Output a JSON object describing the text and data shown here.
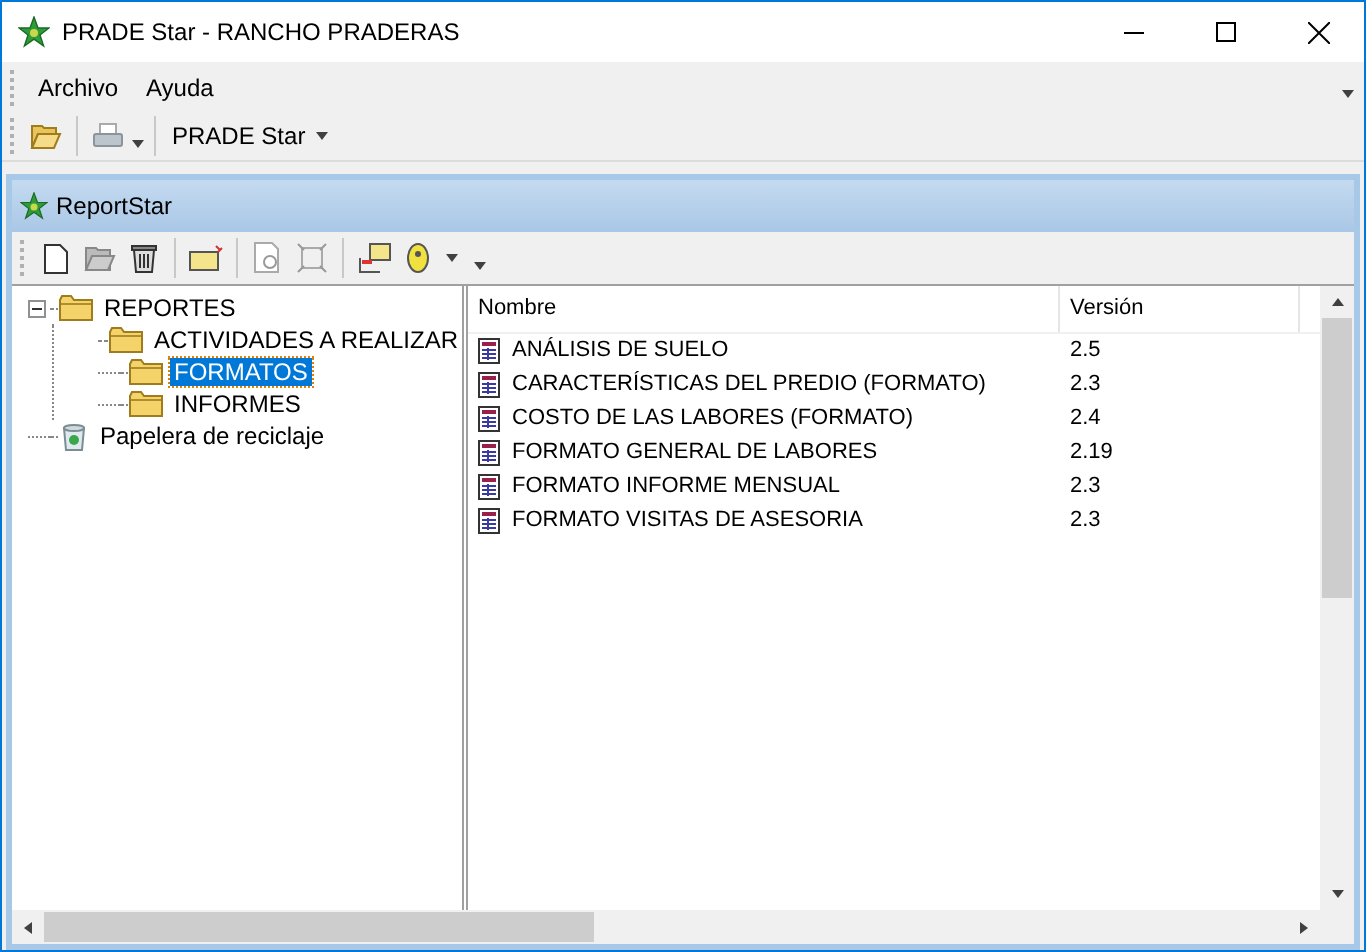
{
  "window": {
    "title": "PRADE Star - RANCHO PRADERAS"
  },
  "menu": [
    {
      "label": "Archivo"
    },
    {
      "label": "Ayuda"
    }
  ],
  "toolbar": {
    "dropdown": {
      "label": "PRADE Star"
    }
  },
  "child_window": {
    "title": "ReportStar"
  },
  "tree": [
    {
      "label": "REPORTES",
      "kind": "folder",
      "expanded": true,
      "selected": false,
      "children": [
        {
          "label": "ACTIVIDADES A REALIZAR",
          "kind": "folder",
          "selected": false
        },
        {
          "label": "FORMATOS",
          "kind": "folder",
          "selected": true
        },
        {
          "label": "INFORMES",
          "kind": "folder",
          "selected": false
        }
      ]
    },
    {
      "label": "Papelera de reciclaje",
      "kind": "bin",
      "selected": false
    }
  ],
  "table": {
    "columns": [
      "Nombre",
      "Versión"
    ],
    "rows": [
      {
        "name": "ANÁLISIS DE SUELO",
        "version": "2.5"
      },
      {
        "name": "CARACTERÍSTICAS DEL PREDIO (FORMATO)",
        "version": "2.3"
      },
      {
        "name": "COSTO DE LAS LABORES (FORMATO)",
        "version": "2.4"
      },
      {
        "name": "FORMATO GENERAL DE LABORES",
        "version": "2.19"
      },
      {
        "name": "FORMATO INFORME MENSUAL",
        "version": "2.3"
      },
      {
        "name": "FORMATO VISITAS DE ASESORIA",
        "version": "2.3"
      }
    ]
  }
}
